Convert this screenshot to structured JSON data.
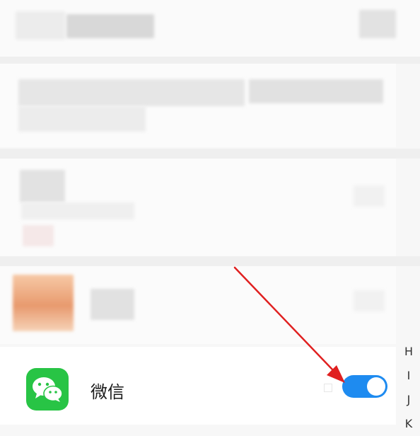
{
  "app_list": {
    "visible_app": {
      "name": "微信",
      "toggle_on": true
    }
  },
  "alpha_index": [
    "H",
    "I",
    "J",
    "K"
  ],
  "colors": {
    "toggle_on": "#1e8bf0",
    "wechat_green": "#28c445",
    "annotation_arrow": "#e02020"
  },
  "icons": {
    "app_icon": "wechat-icon"
  }
}
